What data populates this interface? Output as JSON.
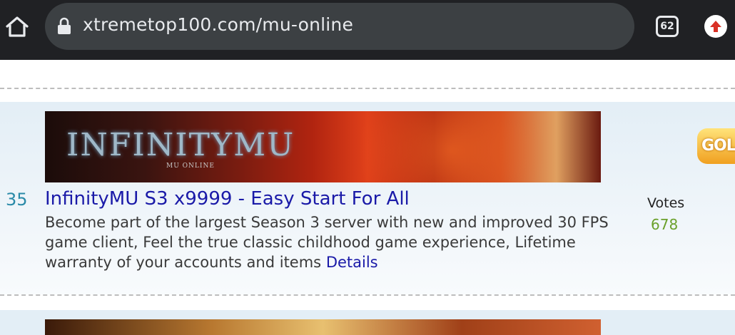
{
  "browser": {
    "url": "xtremetop100.com/mu-online",
    "tab_count": "62",
    "icons": [
      "home-icon",
      "lock-icon",
      "tabs-icon",
      "update-icon"
    ]
  },
  "listing": {
    "rank": "35",
    "banner_logo": "INFINITYMU",
    "banner_subtitle": "MU ONLINE",
    "title": "InfinityMU S3 x9999 - Easy Start For All",
    "description": "Become part of the largest Season 3 server with new and improved 30 FPS game client, Feel the true classic childhood game experience, Lifetime warranty of your accounts and items",
    "details_link": "Details",
    "votes_label": "Votes",
    "votes_value": "678"
  },
  "side_badge": "GOL",
  "colors": {
    "chrome": "#202124",
    "urlbar": "#3c4043",
    "link": "#1a1aa8",
    "rank": "#2a8aa8",
    "votes": "#6aa02a"
  }
}
